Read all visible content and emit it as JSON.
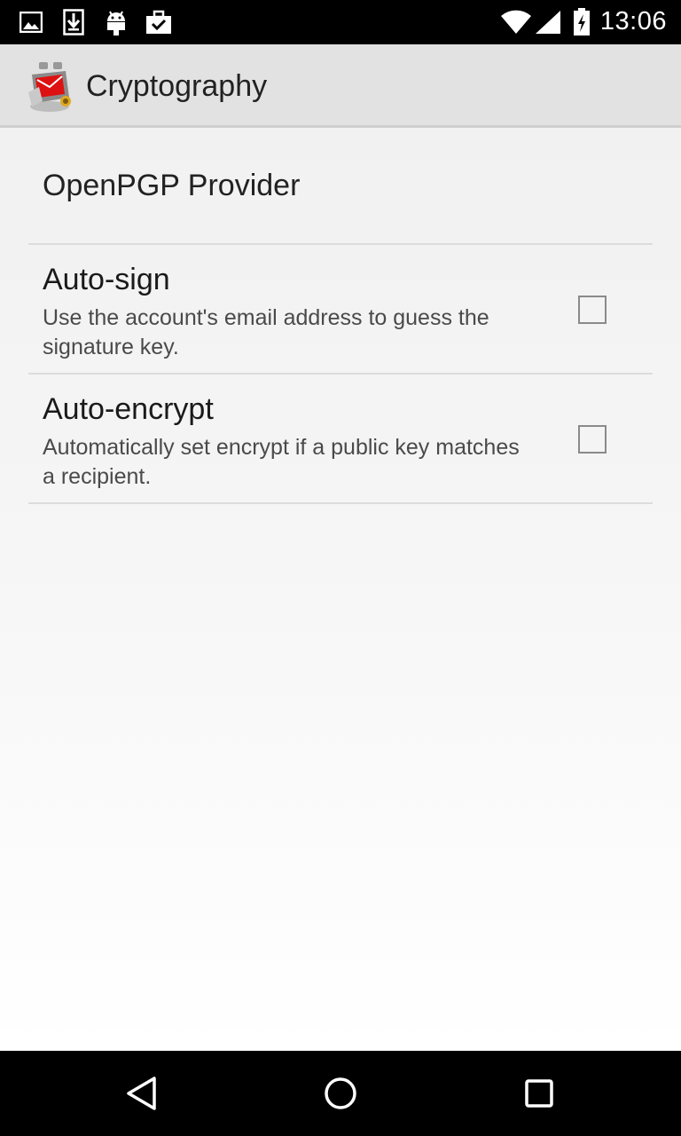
{
  "status_bar": {
    "time": "13:06",
    "left_icons": [
      "image-icon",
      "download-icon",
      "android-icon",
      "briefcase-check-icon"
    ],
    "right_icons": [
      "wifi-icon",
      "signal-icon",
      "battery-charging-icon"
    ]
  },
  "app_bar": {
    "title": "Cryptography",
    "logo_icon": "app-logo-icon"
  },
  "preferences": {
    "header": "OpenPGP Provider",
    "items": [
      {
        "title": "Auto-sign",
        "summary": "Use the account's email address to guess the signature key.",
        "checked": false
      },
      {
        "title": "Auto-encrypt",
        "summary": "Automatically set encrypt if a public key matches a recipient.",
        "checked": false
      }
    ]
  },
  "nav_bar": {
    "buttons": [
      "back-icon",
      "home-icon",
      "recents-icon"
    ]
  },
  "colors": {
    "app_bar_bg": "#e2e2e2",
    "content_bg": "#f1f1f1",
    "divider": "#dcdcdc",
    "system_bar_bg": "#000000"
  }
}
